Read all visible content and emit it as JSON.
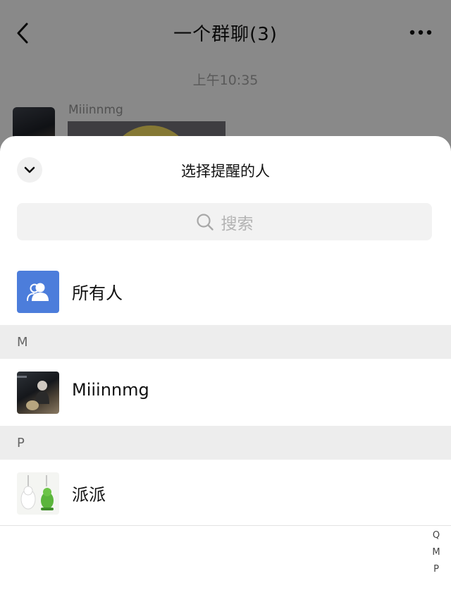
{
  "chat": {
    "title": "一个群聊(3)",
    "time": "上午10:35",
    "message_sender": "Miiinnmg",
    "icons": {
      "back": "chevron-left-icon",
      "more": "more-dots-icon"
    }
  },
  "sheet": {
    "title": "选择提醒的人",
    "collapse_icon": "chevron-down-icon",
    "search": {
      "placeholder": "搜索",
      "icon": "search-icon"
    },
    "everyone": {
      "label": "所有人",
      "icon": "group-icon",
      "color": "#4c7ddb"
    },
    "sections": [
      {
        "letter": "M",
        "members": [
          {
            "name": "Miiinnmg"
          }
        ]
      },
      {
        "letter": "P",
        "members": [
          {
            "name": "派派"
          }
        ]
      }
    ],
    "index_bar": [
      "Q",
      "M",
      "P"
    ]
  },
  "colors": {
    "overlay": "rgba(0,0,0,0.42)",
    "section_bg": "#ededed",
    "accent": "#4c7ddb"
  }
}
